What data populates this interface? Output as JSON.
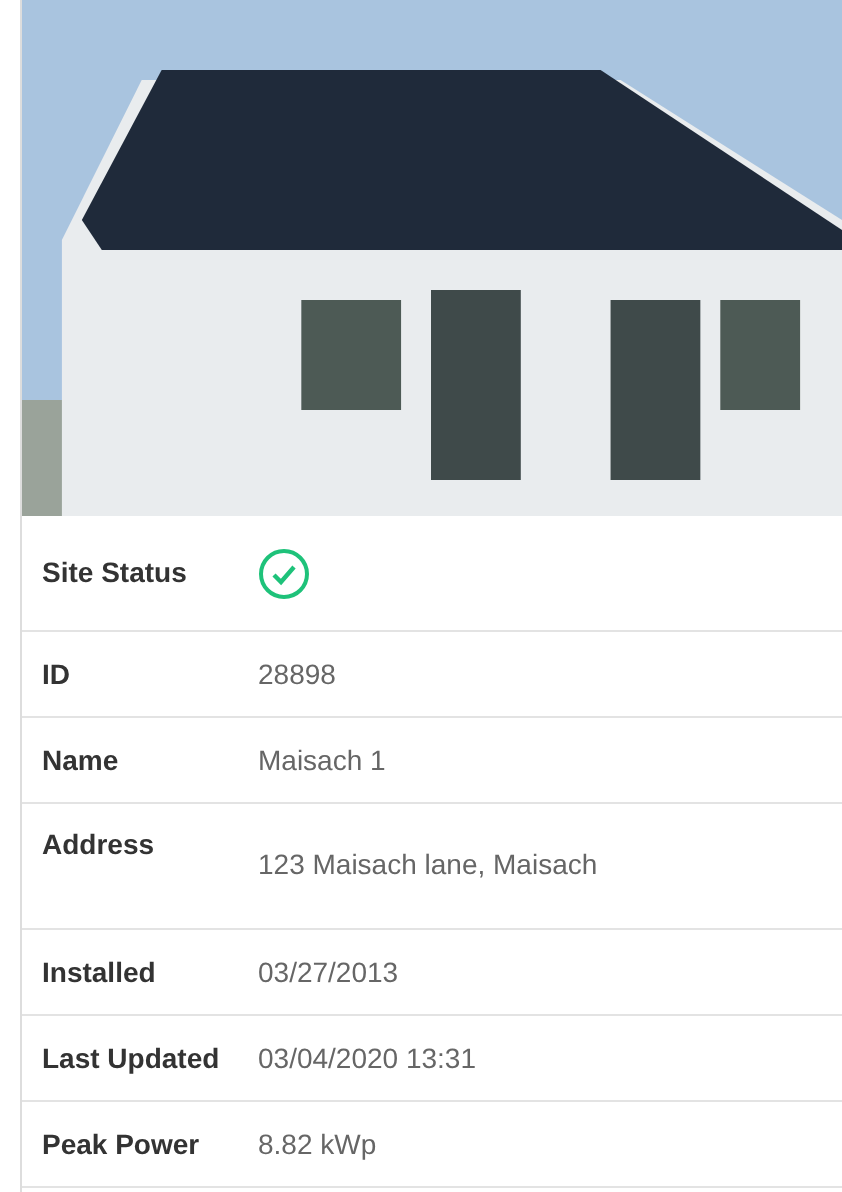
{
  "photo": {
    "kind": "house-photo"
  },
  "details": [
    {
      "label": "Site Status",
      "kind": "status",
      "ok": true
    },
    {
      "label": "ID",
      "kind": "text",
      "value": "28898"
    },
    {
      "label": "Name",
      "kind": "text",
      "value": "Maisach 1"
    },
    {
      "label": "Address",
      "kind": "text",
      "value": "123 Maisach lane,  Maisach",
      "tall": true
    },
    {
      "label": "Installed",
      "kind": "text",
      "value": "03/27/2013"
    },
    {
      "label": "Last Updated",
      "kind": "text",
      "value": "03/04/2020 13:31"
    },
    {
      "label": "Peak Power",
      "kind": "text",
      "value": "8.82 kWp"
    }
  ]
}
